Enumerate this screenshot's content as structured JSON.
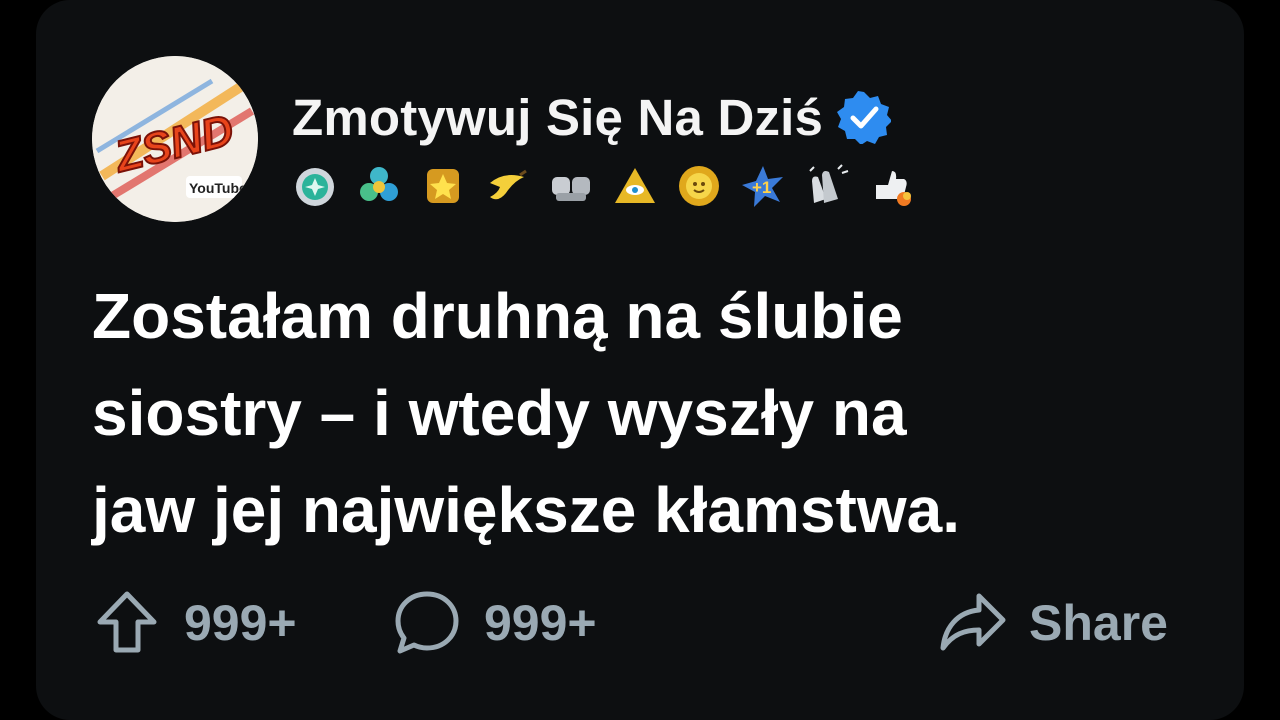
{
  "post": {
    "author": {
      "name": "Zmotywuj Się Na Dziś",
      "avatar_text": "ZSND",
      "avatar_badge": "YouTube",
      "verified": true,
      "badges": [
        "medal-icon",
        "flower-gems-icon",
        "star-badge-icon",
        "banana-icon",
        "fist-bump-icon",
        "pyramid-eye-icon",
        "sun-face-icon",
        "plus-one-icon",
        "clapping-hands-icon",
        "rocket-thumb-icon"
      ]
    },
    "title_lines": [
      "Zostałam druhną na ślubie",
      "siostry – i wtedy wyszły na",
      "jaw jej największe kłamstwa."
    ],
    "actions": {
      "upvotes": "999+",
      "comments": "999+",
      "share_label": "Share"
    }
  },
  "colors": {
    "background": "#0d0f11",
    "text": "#ffffff",
    "muted": "#9aa9b3",
    "verified": "#2e8cf0"
  }
}
